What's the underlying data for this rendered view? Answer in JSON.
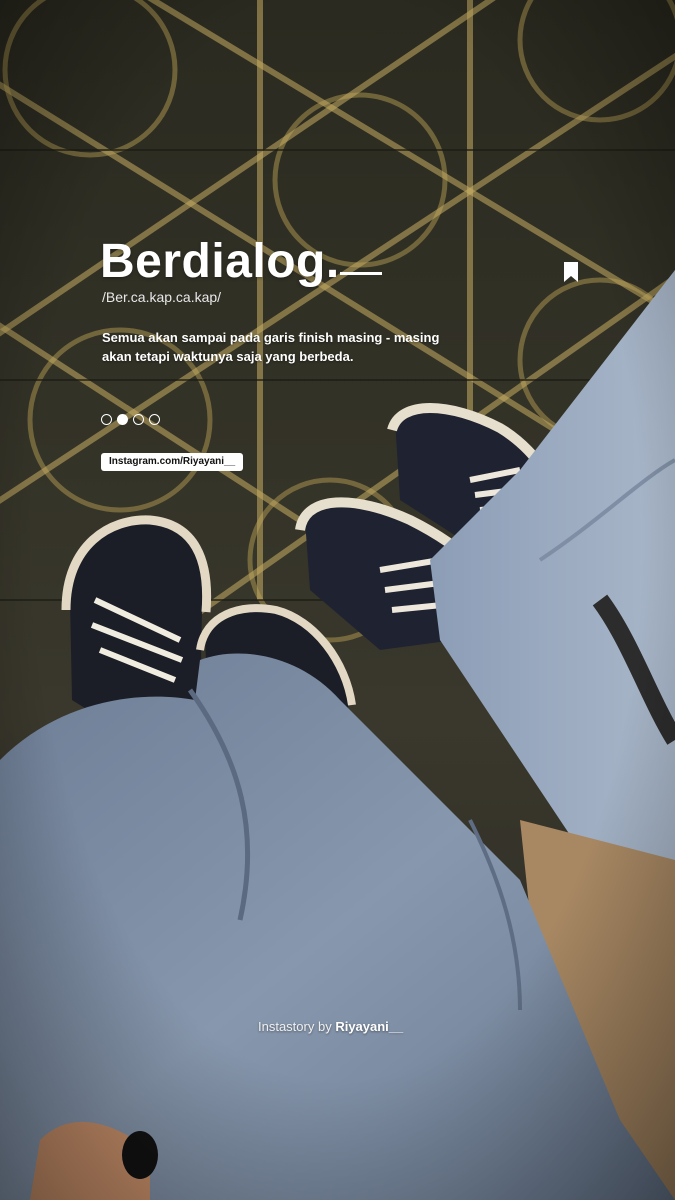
{
  "story": {
    "title": "Berdialog.",
    "phonetic": "/Ber.ca.kap.ca.kap/",
    "quote": "Semua akan sampai pada garis finish masing - masing akan tetapi waktunya saja yang berbeda.",
    "instagram_tag": "Instagram.com/Riyayani__",
    "credit_prefix": "Instastory by ",
    "credit_handle": "Riyayani__",
    "pagination": {
      "total": 4,
      "active_index": 1
    },
    "icons": {
      "bookmark": "bookmark-icon"
    }
  },
  "photo": {
    "subject": "two pairs of sneakers and jeans on a patterned carpet",
    "colors": {
      "carpet": "#2e2d25",
      "carpet_pattern": "#b8a15a",
      "denim": "#7d8fa6",
      "sneaker_canvas": "#1c1f2a",
      "sneaker_sole": "#e4dccb"
    }
  }
}
